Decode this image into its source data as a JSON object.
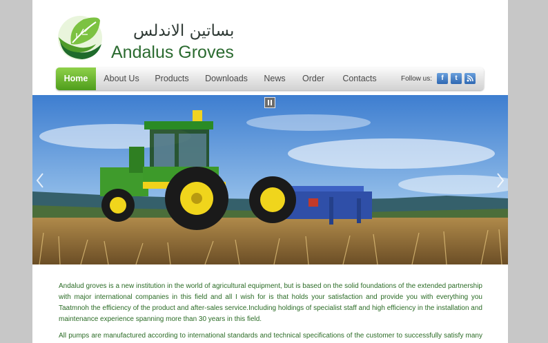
{
  "logo": {
    "arabic": "بساتين الاندلس",
    "latin": "Andalus Groves"
  },
  "nav": {
    "items": [
      {
        "label": "Home",
        "active": true
      },
      {
        "label": "About Us",
        "active": false
      },
      {
        "label": "Products",
        "active": false
      },
      {
        "label": "Downloads",
        "active": false
      },
      {
        "label": "News",
        "active": false
      },
      {
        "label": "Order",
        "active": false
      },
      {
        "label": "Contacts",
        "active": false
      }
    ],
    "follow_label": "Follow us:",
    "social": [
      "f",
      "t",
      "rss"
    ]
  },
  "colors": {
    "accent_green": "#5aaa22",
    "text_green": "#2a6b25",
    "nav_text": "#4a4a4a"
  },
  "content": {
    "paragraph_1": "Andalud groves is a new institution in the world of agricultural equipment, but is based on the solid foundations of the extended partnership with major international companies in this field and all I wish for is that holds your satisfaction and provide you with everything you Taatmnoh the efficiency of the product and after-sales service.Including holdings of specialist staff and high efficiency in the installation and maintenance experience spanning more than 30 years in this field.",
    "paragraph_2": "All pumps are manufactured according to international standards and technical specifications of the customer to successfully satisfy many application areas"
  }
}
